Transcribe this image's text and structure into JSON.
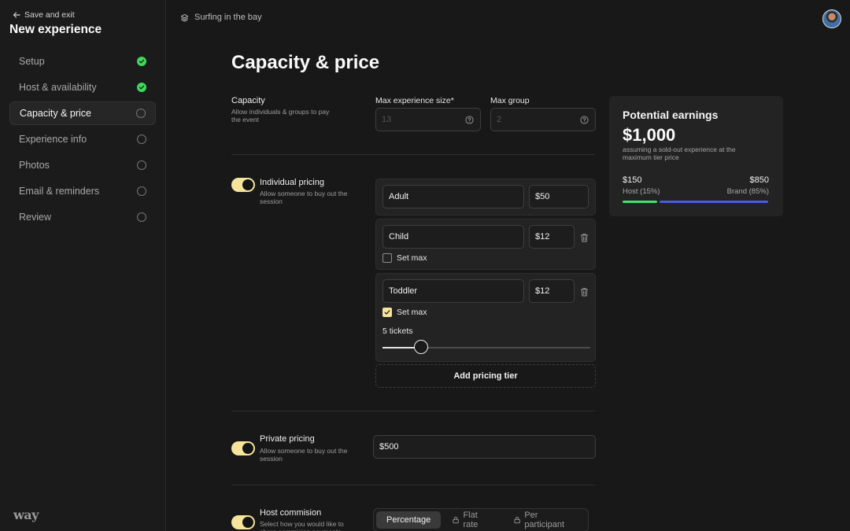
{
  "sidebar": {
    "back_label": "Save and exit",
    "title": "New experience",
    "steps": [
      {
        "label": "Setup",
        "status": "done"
      },
      {
        "label": "Host & availability",
        "status": "done"
      },
      {
        "label": "Capacity & price",
        "status": "current"
      },
      {
        "label": "Experience info",
        "status": "todo"
      },
      {
        "label": "Photos",
        "status": "todo"
      },
      {
        "label": "Email & reminders",
        "status": "todo"
      },
      {
        "label": "Review",
        "status": "todo"
      }
    ],
    "logo": "way"
  },
  "topbar": {
    "breadcrumb": "Surfing in the bay"
  },
  "page_title": "Capacity & price",
  "capacity": {
    "label": "Capacity",
    "description": "Allow individuals & groups to pay the event",
    "max_size_label": "Max experience size*",
    "max_size_placeholder": "13",
    "max_group_label": "Max group",
    "max_group_placeholder": "2"
  },
  "individual_pricing": {
    "label": "Individual pricing",
    "description": "Allow someone to buy out the session",
    "enabled": true,
    "tiers": [
      {
        "name": "Adult",
        "price": "$50"
      },
      {
        "name": "Child",
        "price": "$12",
        "set_max_label": "Set max",
        "set_max": false
      },
      {
        "name": "Toddler",
        "price": "$12",
        "set_max_label": "Set max",
        "set_max": true,
        "max_tickets_label": "5 tickets",
        "max_tickets": 5
      }
    ],
    "add_tier_label": "Add pricing tier"
  },
  "private_pricing": {
    "label": "Private pricing",
    "description": "Allow someone to buy out the session",
    "enabled": true,
    "price": "$500"
  },
  "host_commission": {
    "label": "Host commision",
    "description": "Select how you would like to share commision payments",
    "enabled": true,
    "options": [
      "Percentage",
      "Flat rate",
      "Per participant"
    ],
    "selected": "Percentage"
  },
  "earnings": {
    "title": "Potential earnings",
    "total": "$1,000",
    "note": "assuming a sold-out experience at the maximum tier price",
    "host_value": "$150",
    "host_label": "Host (15%)",
    "brand_value": "$850",
    "brand_label": "Brand (85%)",
    "host_share": 0.15,
    "brand_share": 0.85,
    "host_color": "#4ade6a",
    "brand_color": "#4b5ce0"
  },
  "colors": {
    "accent": "#f5e49a",
    "done": "#3ed85b",
    "background": "#181818"
  }
}
